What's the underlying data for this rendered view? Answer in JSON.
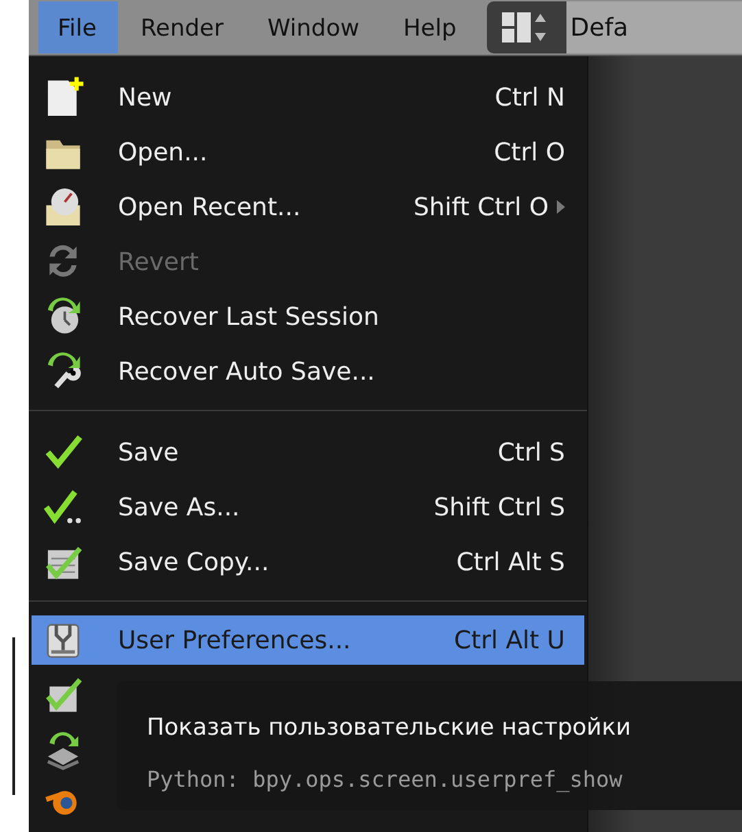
{
  "menubar": {
    "menus": [
      {
        "label": "File",
        "selected": true
      },
      {
        "label": "Render",
        "selected": false
      },
      {
        "label": "Window",
        "selected": false
      },
      {
        "label": "Help",
        "selected": false
      }
    ]
  },
  "layout_field": {
    "value": "Defa"
  },
  "file_menu": {
    "sections": [
      {
        "items": [
          {
            "kind": "item",
            "label": "New",
            "shortcut": "Ctrl N",
            "disabled": false,
            "selected": false,
            "submenu": false
          },
          {
            "kind": "item",
            "label": "Open...",
            "shortcut": "Ctrl O",
            "disabled": false,
            "selected": false,
            "submenu": false
          },
          {
            "kind": "item",
            "label": "Open Recent...",
            "shortcut": "Shift Ctrl O",
            "disabled": false,
            "selected": false,
            "submenu": true
          },
          {
            "kind": "item",
            "label": "Revert",
            "disabled": true,
            "selected": false,
            "submenu": false
          },
          {
            "kind": "item",
            "label": "Recover Last Session",
            "disabled": false,
            "selected": false,
            "submenu": false
          },
          {
            "kind": "item",
            "label": "Recover Auto Save...",
            "disabled": false,
            "selected": false,
            "submenu": false
          }
        ]
      },
      {
        "items": [
          {
            "kind": "item",
            "label": "Save",
            "shortcut": "Ctrl S",
            "disabled": false,
            "selected": false,
            "submenu": false
          },
          {
            "kind": "item",
            "label": "Save As...",
            "shortcut": "Shift Ctrl S",
            "disabled": false,
            "selected": false,
            "submenu": false
          },
          {
            "kind": "item",
            "label": "Save Copy...",
            "shortcut": "Ctrl Alt S",
            "disabled": false,
            "selected": false,
            "submenu": false
          }
        ]
      },
      {
        "items": [
          {
            "kind": "item",
            "label": "User Preferences...",
            "shortcut": "Ctrl Alt U",
            "disabled": false,
            "selected": true,
            "submenu": false
          },
          {
            "kind": "icon_only"
          },
          {
            "kind": "icon_only"
          },
          {
            "kind": "icon_only"
          }
        ]
      }
    ]
  },
  "tooltip": {
    "title": "Показать пользовательские настройки",
    "python": "Python: bpy.ops.screen.userpref_show"
  }
}
